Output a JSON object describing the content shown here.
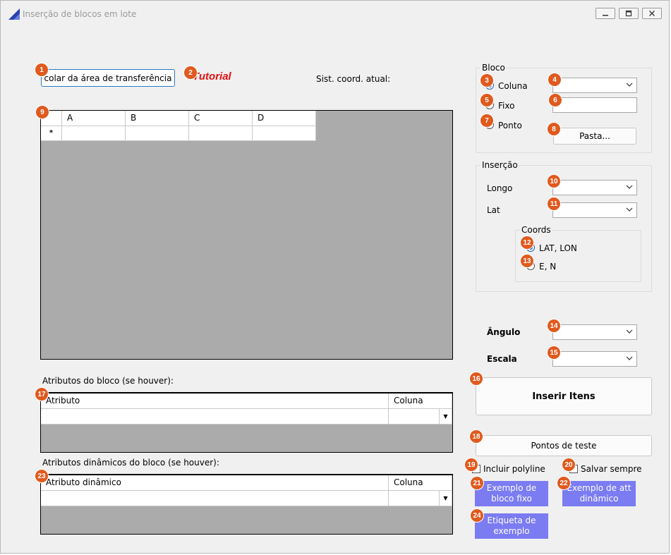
{
  "window": {
    "title": "Inserção de blocos em lote",
    "controls": [
      "minimize-icon",
      "maximize-icon",
      "close-icon"
    ]
  },
  "top": {
    "paste_button": "colar da área de transferência",
    "tutorial_link": "Tutorial",
    "coord_label": "Sist. coord. atual:"
  },
  "main_grid": {
    "columns": [
      "A",
      "B",
      "C",
      "D"
    ],
    "new_row_marker": "*"
  },
  "bloco": {
    "title": "Bloco",
    "radios": [
      {
        "label": "Coluna",
        "selected": true
      },
      {
        "label": "Fixo",
        "selected": false
      },
      {
        "label": "Ponto",
        "selected": false
      }
    ],
    "folder_button": "Pasta..."
  },
  "insercao": {
    "title": "Inserção",
    "longo_label": "Longo",
    "lat_label": "Lat",
    "coords": {
      "title": "Coords",
      "radios": [
        {
          "label": "LAT, LON",
          "selected": true
        },
        {
          "label": "E, N",
          "selected": false
        }
      ]
    }
  },
  "angulo_label": "Ângulo",
  "escala_label": "Escala",
  "insert_button": "Inserir Itens",
  "test_points_button": "Pontos de teste",
  "checks": {
    "polyline": "Incluir polyline",
    "save_always": "Salvar sempre"
  },
  "example_buttons": {
    "fixed_block": "Exemplo de bloco fixo",
    "dynamic_att": "Exemplo de att dinâmico",
    "label": "Etiqueta de exemplo"
  },
  "attributes": {
    "title": "Atributos do bloco (se houver):",
    "col1": "Atributo",
    "col2": "Coluna"
  },
  "dynamic_attributes": {
    "title": "Atributos dinâmicos do bloco (se houver):",
    "col1": "Atributo dinâmico",
    "col2": "Coluna"
  },
  "badges": [
    "1",
    "2",
    "3",
    "4",
    "5",
    "6",
    "7",
    "8",
    "9",
    "10",
    "11",
    "12",
    "13",
    "14",
    "15",
    "16",
    "17",
    "18",
    "19",
    "20",
    "21",
    "22",
    "23",
    "24"
  ],
  "colors": {
    "badge": "#e05a1e",
    "example_button": "#7b7bf2",
    "tutorial": "#e01010",
    "grid_bg": "#ababab"
  }
}
